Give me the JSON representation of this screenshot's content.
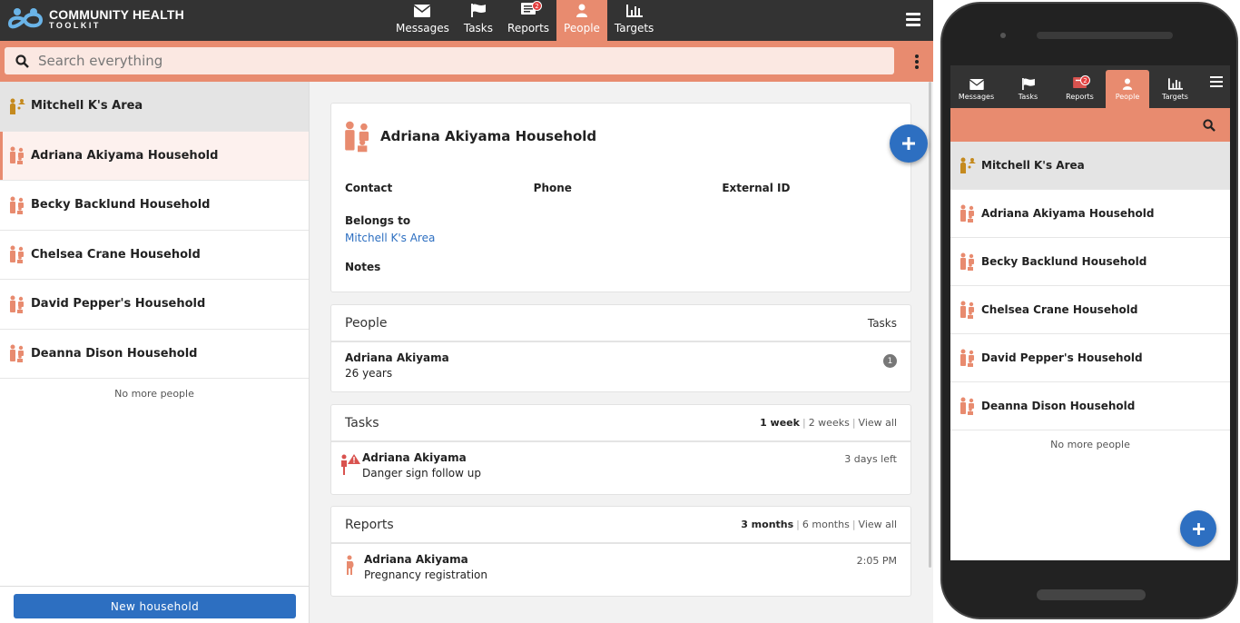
{
  "app": {
    "logo_line1": "COMMUNITY HEALTH",
    "logo_line2": "TOOLKIT"
  },
  "nav": {
    "items": [
      {
        "label": "Messages",
        "icon": "envelope-icon"
      },
      {
        "label": "Tasks",
        "icon": "flag-icon"
      },
      {
        "label": "Reports",
        "icon": "report-icon",
        "badge": "2"
      },
      {
        "label": "People",
        "icon": "person-icon",
        "active": true
      },
      {
        "label": "Targets",
        "icon": "bar-chart-icon"
      }
    ]
  },
  "search": {
    "placeholder": "Search everything"
  },
  "left_list": {
    "items": [
      {
        "label": "Mitchell K's Area",
        "type": "area"
      },
      {
        "label": "Adriana Akiyama Household",
        "type": "household",
        "selected": true
      },
      {
        "label": "Becky Backlund Household",
        "type": "household"
      },
      {
        "label": "Chelsea Crane Household",
        "type": "household"
      },
      {
        "label": "David Pepper's Household",
        "type": "household"
      },
      {
        "label": "Deanna Dison Household",
        "type": "household"
      }
    ],
    "no_more": "No more people",
    "new_household": "New household"
  },
  "detail": {
    "title": "Adriana Akiyama Household",
    "fields": [
      "Contact",
      "Phone",
      "External ID"
    ],
    "belongs_to_label": "Belongs to",
    "belongs_to_value": "Mitchell K's Area",
    "notes_label": "Notes",
    "people": {
      "heading": "People",
      "right": "Tasks",
      "person_name": "Adriana Akiyama",
      "person_age": "26 years",
      "task_count": "1"
    },
    "tasks": {
      "heading": "Tasks",
      "filter_active": "1 week",
      "filter_2": "2 weeks",
      "filter_3": "View all",
      "item_name": "Adriana Akiyama",
      "item_desc": "Danger sign follow up",
      "item_due": "3 days left"
    },
    "reports": {
      "heading": "Reports",
      "filter_active": "3 months",
      "filter_2": "6 months",
      "filter_3": "View all",
      "item_name": "Adriana Akiyama",
      "item_desc": "Pregnancy registration",
      "item_time": "2:05 PM"
    }
  },
  "phone": {
    "reports_badge": "2",
    "no_more": "No more people"
  },
  "colors": {
    "accent": "#e88b6f",
    "header": "#333333",
    "primary_blue": "#2d6fc1",
    "area_gold": "#c58a1e"
  }
}
